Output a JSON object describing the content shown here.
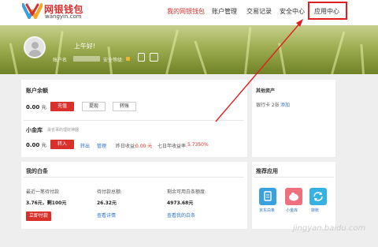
{
  "brand": {
    "name_cn": "网银钱包",
    "domain": "wangyin.com",
    "logo_icon": "v-shaped logo"
  },
  "nav": [
    {
      "label": "我的网银钱包",
      "active": true
    },
    {
      "label": "账户管理",
      "active": false
    },
    {
      "label": "交易记录",
      "active": false
    },
    {
      "label": "安全中心",
      "active": false
    },
    {
      "label": "应用中心",
      "active": false,
      "highlighted": true
    }
  ],
  "user": {
    "greeting": "上午好!",
    "account_label": "账户名",
    "security_label": "安全等级:",
    "badge_icons": [
      "phone-icon",
      "id-card-icon"
    ]
  },
  "balance": {
    "title": "账户余额",
    "amount": "0.00",
    "unit": "元",
    "recharge_button": "充值",
    "withdraw_button": "提现",
    "transfer_button": "转账"
  },
  "vault": {
    "title": "小金库",
    "subtitle": "最省事的理财神器",
    "amount": "0.00",
    "unit": "元",
    "in_button": "转入",
    "out_link": "转出",
    "manage_link": "管理",
    "yesterday_label": "昨日收益:",
    "yesterday_value": "0.00 元",
    "rate_label": "七日年收益率:",
    "rate_value": "5.7350%"
  },
  "other_assets": {
    "title": "其他资产",
    "bank_card_label": "银行卡 2张",
    "add_link": "添加"
  },
  "my_white": {
    "title": "我的白条",
    "col1_label": "最近一笔待付款",
    "col1_value": "3.76元，剩100元",
    "col1_button": "立即付款",
    "col2_label": "待付款总额:",
    "col2_value": "26.32元",
    "col2_link": "查看详情",
    "col3_label": "剩余可用白条额度:",
    "col3_value": "4973.68元",
    "col3_link": "查看我的白条"
  },
  "apps": {
    "title": "推荐应用",
    "items": [
      {
        "label": "京东白条",
        "color": "#3aa0de",
        "icon": "receipt-icon"
      },
      {
        "label": "小金库",
        "color": "#f06f7e",
        "icon": "piggy-bank-icon"
      },
      {
        "label": "转账",
        "color": "#36b1e3",
        "icon": "refresh-icon"
      }
    ]
  },
  "watermark": "jingyan.baidu.com",
  "colors": {
    "accent": "#d9302c",
    "link": "#2f73c4",
    "highlight_box": "#e02020"
  }
}
